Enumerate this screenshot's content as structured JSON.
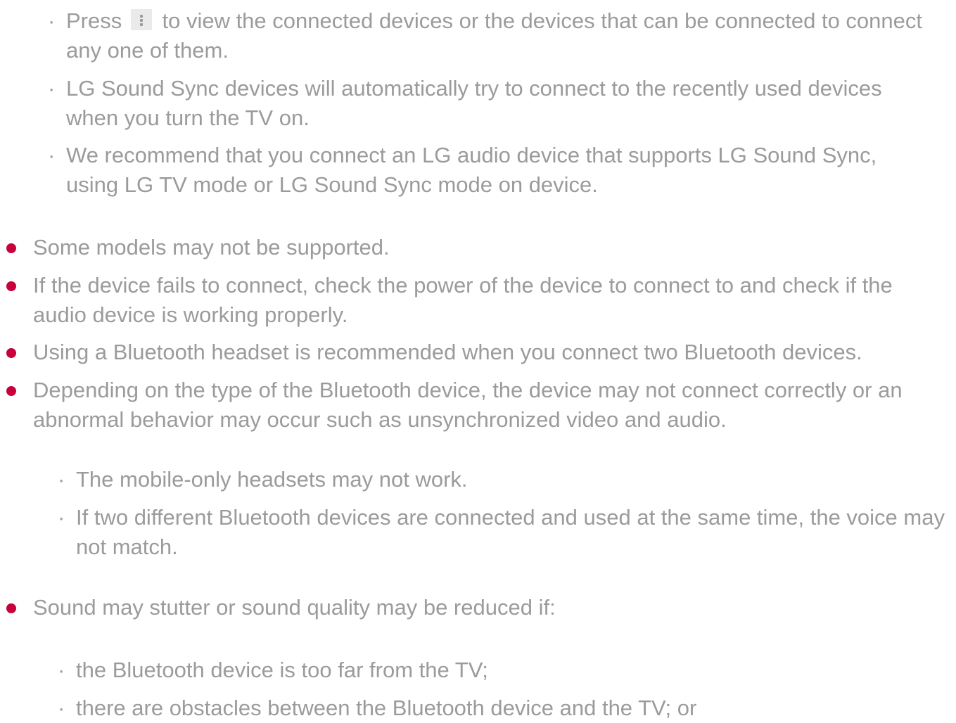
{
  "sub_items_1": [
    {
      "marker": "·",
      "text_before_icon": "Press",
      "icon": "more-options-icon",
      "text_after_icon": "to view the connected devices or the devices that can be connected to connect any one of them."
    },
    {
      "marker": "·",
      "text": "LG Sound Sync devices will automatically try to connect to the recently used devices when you turn the TV on."
    },
    {
      "marker": "·",
      "text": "We recommend that you connect an LG audio device that supports LG Sound Sync, using LG TV mode or LG Sound Sync mode on device."
    }
  ],
  "bullets": [
    {
      "text": "Some models may not be supported."
    },
    {
      "text": "If the device fails to connect, check the power of the device to connect to and check if the audio device is working properly."
    },
    {
      "text": "Using a Bluetooth headset is recommended when you connect two Bluetooth devices."
    },
    {
      "text": "Depending on the type of the Bluetooth device, the device may not connect correctly or an abnormal behavior may occur such as unsynchronized video and audio."
    },
    {
      "text": "Sound may stutter or sound quality may be reduced if:"
    }
  ],
  "sub_items_2": [
    {
      "marker": "·",
      "text": "The mobile-only headsets may not work."
    },
    {
      "marker": "·",
      "text": "If two different Bluetooth devices are connected and used at the same time, the voice may not match."
    }
  ],
  "sub_items_3": [
    {
      "marker": "·",
      "text": "the Bluetooth device is too far from the TV;"
    },
    {
      "marker": "·",
      "text": "there are obstacles between the Bluetooth device and the TV; or"
    }
  ],
  "colors": {
    "text": "#9b9b9b",
    "bullet": "#c8003c",
    "icon_bg": "#eaeaea"
  }
}
